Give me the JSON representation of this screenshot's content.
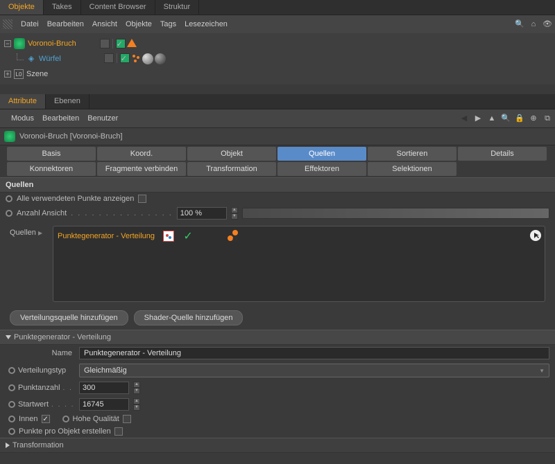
{
  "topTabs": {
    "objects": "Objekte",
    "takes": "Takes",
    "contentBrowser": "Content Browser",
    "structure": "Struktur"
  },
  "objMenu": {
    "file": "Datei",
    "edit": "Bearbeiten",
    "view": "Ansicht",
    "objects": "Objekte",
    "tags": "Tags",
    "bookmarks": "Lesezeichen"
  },
  "tree": {
    "voronoi": "Voronoi-Bruch",
    "cube": "Würfel",
    "scene": "Szene"
  },
  "attrTabs": {
    "attribute": "Attribute",
    "layers": "Ebenen"
  },
  "attrMenu": {
    "mode": "Modus",
    "edit": "Bearbeiten",
    "user": "Benutzer"
  },
  "objTitle": "Voronoi-Bruch [Voronoi-Bruch]",
  "tabs": {
    "basis": "Basis",
    "coord": "Koord.",
    "object": "Objekt",
    "sources": "Quellen",
    "sort": "Sortieren",
    "details": "Details",
    "connectors": "Konnektoren",
    "fragLink": "Fragmente verbinden",
    "transform": "Transformation",
    "effectors": "Effektoren",
    "selections": "Selektionen"
  },
  "sourcesSection": {
    "header": "Quellen",
    "showAllPoints": "Alle verwendeten Punkte anzeigen",
    "countView": "Anzahl Ansicht",
    "countViewValue": "100 %",
    "srcLabel": "Quellen",
    "srcItem": "Punktegenerator - Verteilung",
    "addDistBtn": "Verteilungsquelle hinzufügen",
    "addShaderBtn": "Shader-Quelle hinzufügen"
  },
  "pgSection": {
    "header": "Punktegenerator - Verteilung",
    "nameLabel": "Name",
    "nameValue": "Punktegenerator - Verteilung",
    "distTypeLabel": "Verteilungstyp",
    "distTypeValue": "Gleichmäßig",
    "pointCountLabel": "Punktanzahl",
    "pointCountValue": "300",
    "seedLabel": "Startwert",
    "seedValue": "16745",
    "innerLabel": "Innen",
    "hqLabel": "Hohe Qualität",
    "pointsPerObjLabel": "Punkte pro Objekt erstellen",
    "transformHeader": "Transformation"
  }
}
